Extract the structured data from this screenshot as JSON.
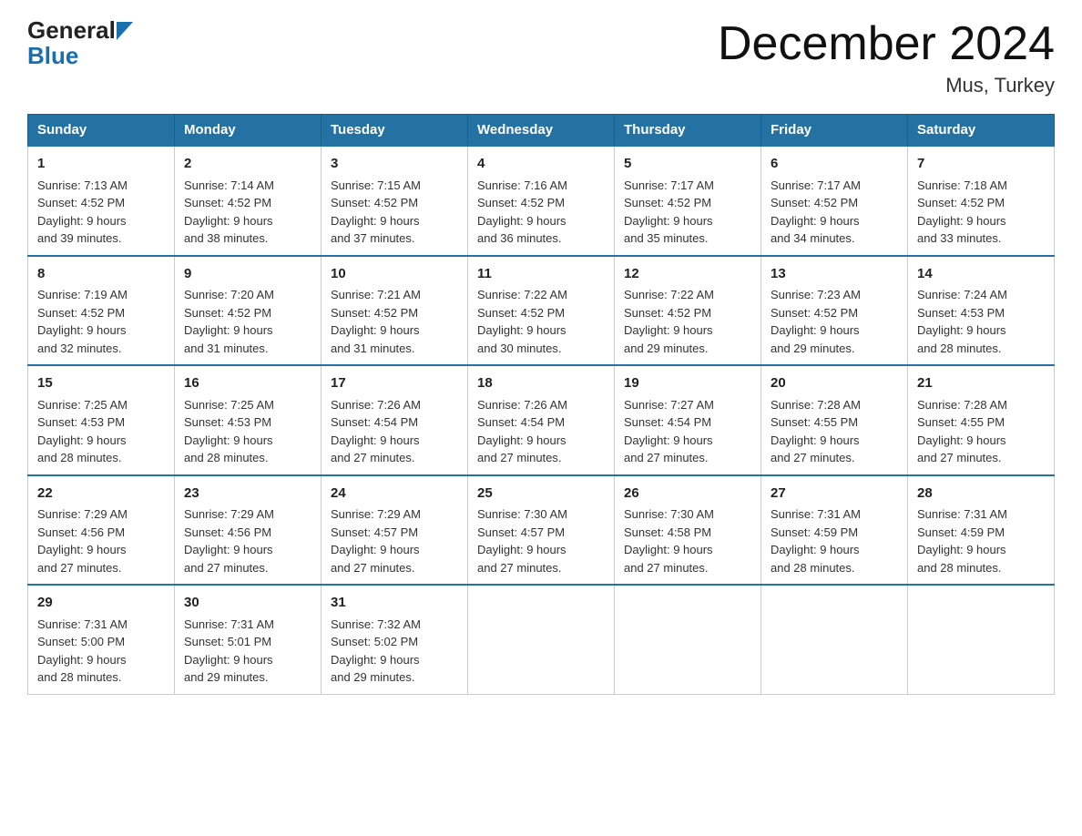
{
  "header": {
    "logo_general": "General",
    "logo_blue": "Blue",
    "month_title": "December 2024",
    "location": "Mus, Turkey"
  },
  "days_of_week": [
    "Sunday",
    "Monday",
    "Tuesday",
    "Wednesday",
    "Thursday",
    "Friday",
    "Saturday"
  ],
  "weeks": [
    [
      {
        "day": "1",
        "sunrise": "7:13 AM",
        "sunset": "4:52 PM",
        "daylight": "9 hours and 39 minutes."
      },
      {
        "day": "2",
        "sunrise": "7:14 AM",
        "sunset": "4:52 PM",
        "daylight": "9 hours and 38 minutes."
      },
      {
        "day": "3",
        "sunrise": "7:15 AM",
        "sunset": "4:52 PM",
        "daylight": "9 hours and 37 minutes."
      },
      {
        "day": "4",
        "sunrise": "7:16 AM",
        "sunset": "4:52 PM",
        "daylight": "9 hours and 36 minutes."
      },
      {
        "day": "5",
        "sunrise": "7:17 AM",
        "sunset": "4:52 PM",
        "daylight": "9 hours and 35 minutes."
      },
      {
        "day": "6",
        "sunrise": "7:17 AM",
        "sunset": "4:52 PM",
        "daylight": "9 hours and 34 minutes."
      },
      {
        "day": "7",
        "sunrise": "7:18 AM",
        "sunset": "4:52 PM",
        "daylight": "9 hours and 33 minutes."
      }
    ],
    [
      {
        "day": "8",
        "sunrise": "7:19 AM",
        "sunset": "4:52 PM",
        "daylight": "9 hours and 32 minutes."
      },
      {
        "day": "9",
        "sunrise": "7:20 AM",
        "sunset": "4:52 PM",
        "daylight": "9 hours and 31 minutes."
      },
      {
        "day": "10",
        "sunrise": "7:21 AM",
        "sunset": "4:52 PM",
        "daylight": "9 hours and 31 minutes."
      },
      {
        "day": "11",
        "sunrise": "7:22 AM",
        "sunset": "4:52 PM",
        "daylight": "9 hours and 30 minutes."
      },
      {
        "day": "12",
        "sunrise": "7:22 AM",
        "sunset": "4:52 PM",
        "daylight": "9 hours and 29 minutes."
      },
      {
        "day": "13",
        "sunrise": "7:23 AM",
        "sunset": "4:52 PM",
        "daylight": "9 hours and 29 minutes."
      },
      {
        "day": "14",
        "sunrise": "7:24 AM",
        "sunset": "4:53 PM",
        "daylight": "9 hours and 28 minutes."
      }
    ],
    [
      {
        "day": "15",
        "sunrise": "7:25 AM",
        "sunset": "4:53 PM",
        "daylight": "9 hours and 28 minutes."
      },
      {
        "day": "16",
        "sunrise": "7:25 AM",
        "sunset": "4:53 PM",
        "daylight": "9 hours and 28 minutes."
      },
      {
        "day": "17",
        "sunrise": "7:26 AM",
        "sunset": "4:54 PM",
        "daylight": "9 hours and 27 minutes."
      },
      {
        "day": "18",
        "sunrise": "7:26 AM",
        "sunset": "4:54 PM",
        "daylight": "9 hours and 27 minutes."
      },
      {
        "day": "19",
        "sunrise": "7:27 AM",
        "sunset": "4:54 PM",
        "daylight": "9 hours and 27 minutes."
      },
      {
        "day": "20",
        "sunrise": "7:28 AM",
        "sunset": "4:55 PM",
        "daylight": "9 hours and 27 minutes."
      },
      {
        "day": "21",
        "sunrise": "7:28 AM",
        "sunset": "4:55 PM",
        "daylight": "9 hours and 27 minutes."
      }
    ],
    [
      {
        "day": "22",
        "sunrise": "7:29 AM",
        "sunset": "4:56 PM",
        "daylight": "9 hours and 27 minutes."
      },
      {
        "day": "23",
        "sunrise": "7:29 AM",
        "sunset": "4:56 PM",
        "daylight": "9 hours and 27 minutes."
      },
      {
        "day": "24",
        "sunrise": "7:29 AM",
        "sunset": "4:57 PM",
        "daylight": "9 hours and 27 minutes."
      },
      {
        "day": "25",
        "sunrise": "7:30 AM",
        "sunset": "4:57 PM",
        "daylight": "9 hours and 27 minutes."
      },
      {
        "day": "26",
        "sunrise": "7:30 AM",
        "sunset": "4:58 PM",
        "daylight": "9 hours and 27 minutes."
      },
      {
        "day": "27",
        "sunrise": "7:31 AM",
        "sunset": "4:59 PM",
        "daylight": "9 hours and 28 minutes."
      },
      {
        "day": "28",
        "sunrise": "7:31 AM",
        "sunset": "4:59 PM",
        "daylight": "9 hours and 28 minutes."
      }
    ],
    [
      {
        "day": "29",
        "sunrise": "7:31 AM",
        "sunset": "5:00 PM",
        "daylight": "9 hours and 28 minutes."
      },
      {
        "day": "30",
        "sunrise": "7:31 AM",
        "sunset": "5:01 PM",
        "daylight": "9 hours and 29 minutes."
      },
      {
        "day": "31",
        "sunrise": "7:32 AM",
        "sunset": "5:02 PM",
        "daylight": "9 hours and 29 minutes."
      },
      null,
      null,
      null,
      null
    ]
  ],
  "labels": {
    "sunrise": "Sunrise:",
    "sunset": "Sunset:",
    "daylight": "Daylight:"
  }
}
